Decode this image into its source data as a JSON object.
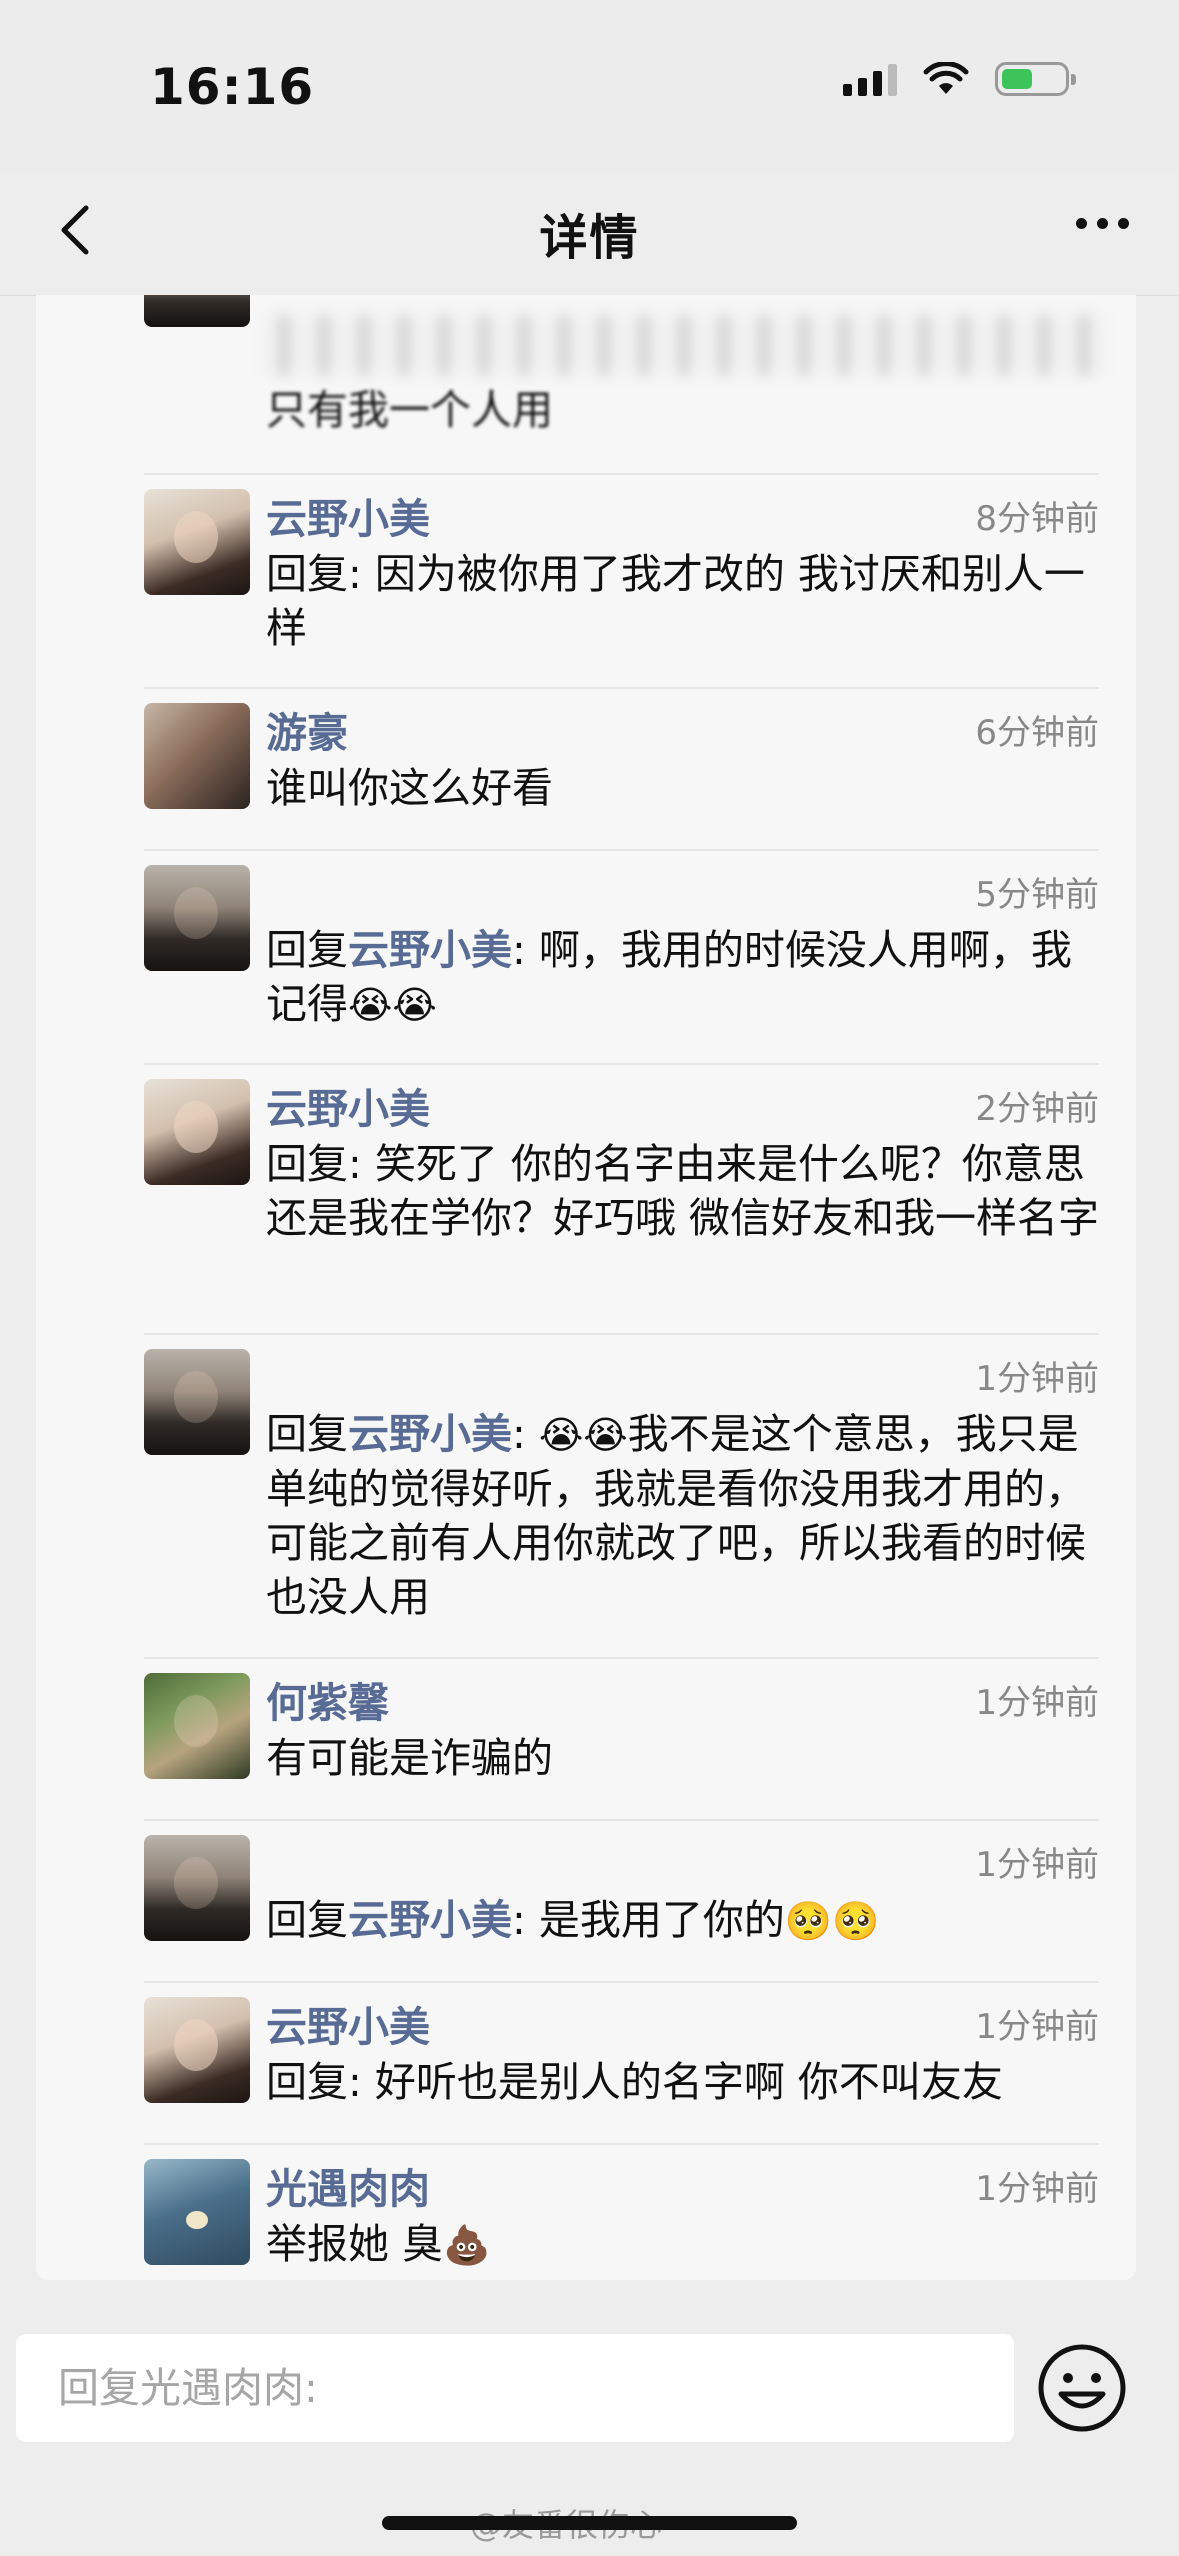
{
  "status_bar": {
    "time": "16:16"
  },
  "nav": {
    "title": "详情"
  },
  "comments": [
    {
      "name": "",
      "time": "",
      "reply_to": "",
      "text": "只有我一个人用",
      "emojis": ""
    },
    {
      "name": "云野小美",
      "time": "8分钟前",
      "reply_prefix": "回复: ",
      "text": "因为被你用了我才改的 我讨厌和别人一样"
    },
    {
      "name": "游豪",
      "time": "6分钟前",
      "text": "谁叫你这么好看"
    },
    {
      "name": "",
      "time": "5分钟前",
      "reply_prefix": "回复",
      "reply_to": "云野小美",
      "text": ": 啊，我用的时候没人用啊，我记得",
      "emojis": "😭😭"
    },
    {
      "name": "云野小美",
      "time": "2分钟前",
      "reply_prefix": "回复: ",
      "text": "笑死了 你的名字由来是什么呢？你意思还是我在学你？好巧哦 微信好友和我一样名字"
    },
    {
      "name": "",
      "time": "1分钟前",
      "reply_prefix": "回复",
      "reply_to": "云野小美",
      "colon": ": ",
      "emojis": "😭😭",
      "text": "我不是这个意思，我只是单纯的觉得好听，我就是看你没用我才用的，可能之前有人用你就改了吧，所以我看的时候也没人用"
    },
    {
      "name": "何紫馨",
      "time": "1分钟前",
      "text": "有可能是诈骗的"
    },
    {
      "name": "",
      "time": "1分钟前",
      "reply_prefix": "回复",
      "reply_to": "云野小美",
      "text": ": 是我用了你的",
      "emojis": "🥺🥺"
    },
    {
      "name": "云野小美",
      "time": "1分钟前",
      "reply_prefix": "回复: ",
      "text": "好听也是别人的名字啊 你不叫友友"
    },
    {
      "name": "光遇肉肉",
      "time": "1分钟前",
      "text": "举报她 臭",
      "emojis": "💩"
    }
  ],
  "input": {
    "placeholder": "回复光遇肉肉:"
  },
  "watermark": "@友番很伤心"
}
